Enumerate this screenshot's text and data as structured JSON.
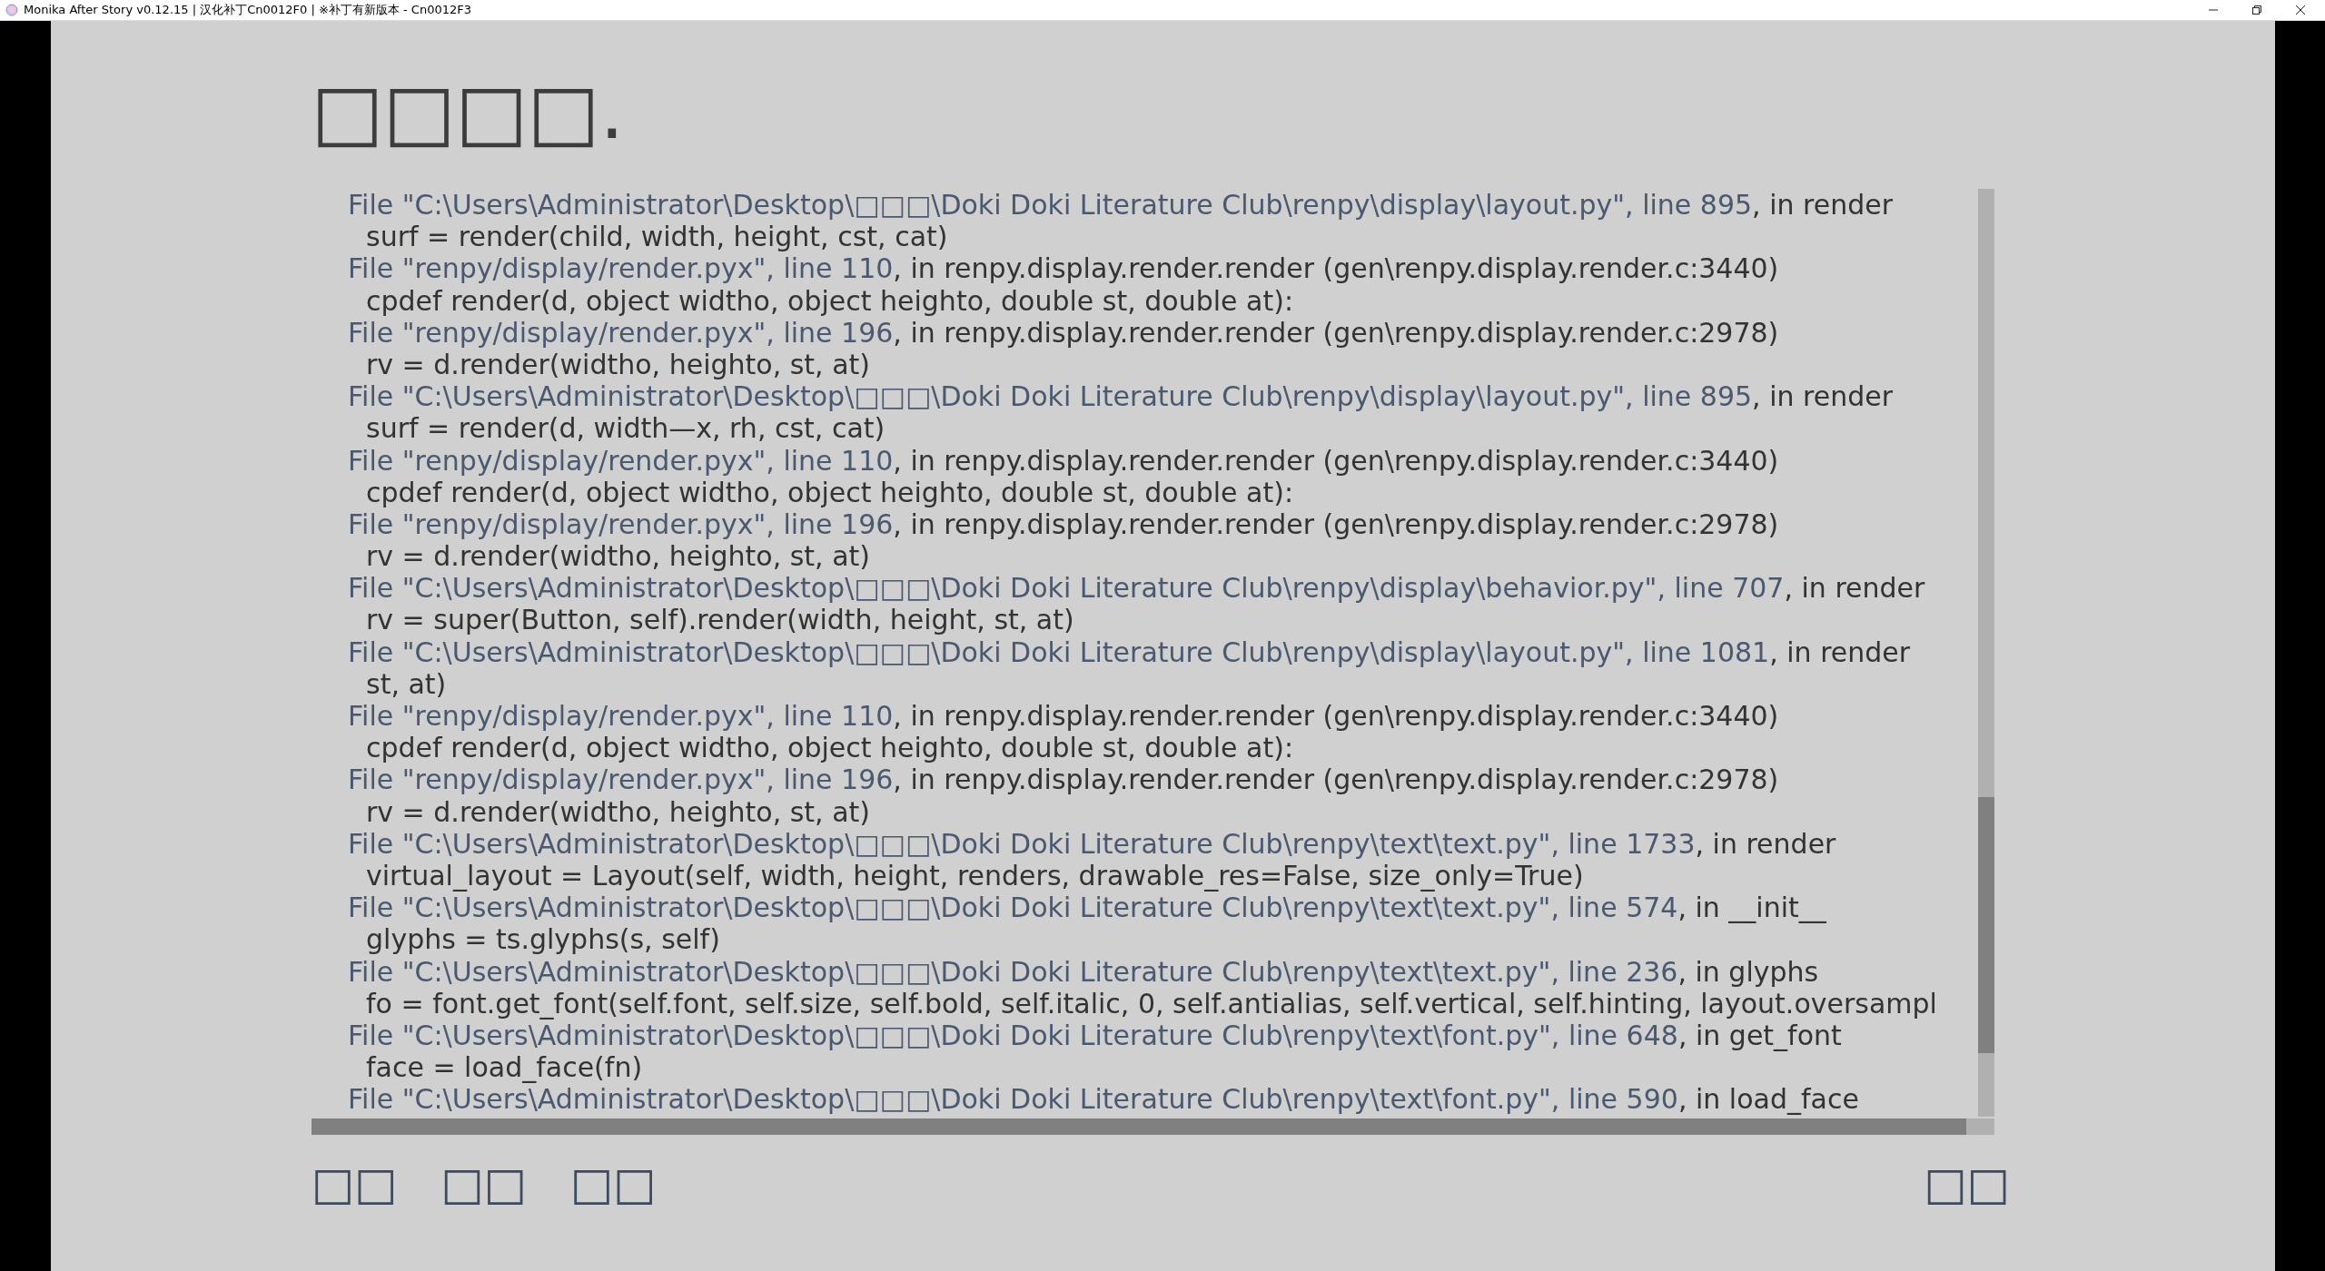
{
  "window": {
    "title": "Monika After Story v0.12.15 | 汉化补丁Cn0012F0 | ※补丁有新版本 - Cn0012F3"
  },
  "heading": "□□□□.",
  "traceback": [
    {
      "kind": "file",
      "location": "File \"C:\\Users\\Administrator\\Desktop\\□□□\\Doki Doki Literature Club\\renpy\\display\\layout.py\", line 895",
      "rest": ", in render"
    },
    {
      "kind": "code",
      "text": "surf = render(child, width, height, cst, cat)"
    },
    {
      "kind": "file",
      "location": "File \"renpy/display/render.pyx\", line 110",
      "rest": ", in renpy.display.render.render (gen\\renpy.display.render.c:3440)"
    },
    {
      "kind": "code",
      "text": "cpdef render(d, object widtho, object heighto, double st, double at):"
    },
    {
      "kind": "file",
      "location": "File \"renpy/display/render.pyx\", line 196",
      "rest": ", in renpy.display.render.render (gen\\renpy.display.render.c:2978)"
    },
    {
      "kind": "code",
      "text": "rv = d.render(widtho, heighto, st, at)"
    },
    {
      "kind": "file",
      "location": "File \"C:\\Users\\Administrator\\Desktop\\□□□\\Doki Doki Literature Club\\renpy\\display\\layout.py\", line 895",
      "rest": ", in render"
    },
    {
      "kind": "code",
      "text": "surf = render(d, width—x, rh, cst, cat)"
    },
    {
      "kind": "file",
      "location": "File \"renpy/display/render.pyx\", line 110",
      "rest": ", in renpy.display.render.render (gen\\renpy.display.render.c:3440)"
    },
    {
      "kind": "code",
      "text": "cpdef render(d, object widtho, object heighto, double st, double at):"
    },
    {
      "kind": "file",
      "location": "File \"renpy/display/render.pyx\", line 196",
      "rest": ", in renpy.display.render.render (gen\\renpy.display.render.c:2978)"
    },
    {
      "kind": "code",
      "text": "rv = d.render(widtho, heighto, st, at)"
    },
    {
      "kind": "file",
      "location": "File \"C:\\Users\\Administrator\\Desktop\\□□□\\Doki Doki Literature Club\\renpy\\display\\behavior.py\", line 707",
      "rest": ", in render"
    },
    {
      "kind": "code",
      "text": "rv = super(Button, self).render(width, height, st, at)"
    },
    {
      "kind": "file",
      "location": "File \"C:\\Users\\Administrator\\Desktop\\□□□\\Doki Doki Literature Club\\renpy\\display\\layout.py\", line 1081",
      "rest": ", in render"
    },
    {
      "kind": "code",
      "text": "st, at)"
    },
    {
      "kind": "file",
      "location": "File \"renpy/display/render.pyx\", line 110",
      "rest": ", in renpy.display.render.render (gen\\renpy.display.render.c:3440)"
    },
    {
      "kind": "code",
      "text": "cpdef render(d, object widtho, object heighto, double st, double at):"
    },
    {
      "kind": "file",
      "location": "File \"renpy/display/render.pyx\", line 196",
      "rest": ", in renpy.display.render.render (gen\\renpy.display.render.c:2978)"
    },
    {
      "kind": "code",
      "text": "rv = d.render(widtho, heighto, st, at)"
    },
    {
      "kind": "file",
      "location": "File \"C:\\Users\\Administrator\\Desktop\\□□□\\Doki Doki Literature Club\\renpy\\text\\text.py\", line 1733",
      "rest": ", in render"
    },
    {
      "kind": "code",
      "text": "virtual_layout = Layout(self, width, height, renders, drawable_res=False, size_only=True)"
    },
    {
      "kind": "file",
      "location": "File \"C:\\Users\\Administrator\\Desktop\\□□□\\Doki Doki Literature Club\\renpy\\text\\text.py\", line 574",
      "rest": ", in __init__"
    },
    {
      "kind": "code",
      "text": "glyphs = ts.glyphs(s, self)"
    },
    {
      "kind": "file",
      "location": "File \"C:\\Users\\Administrator\\Desktop\\□□□\\Doki Doki Literature Club\\renpy\\text\\text.py\", line 236",
      "rest": ", in glyphs"
    },
    {
      "kind": "code",
      "text": "fo = font.get_font(self.font, self.size, self.bold, self.italic, 0, self.antialias, self.vertical, self.hinting, layout.oversampl"
    },
    {
      "kind": "file",
      "location": "File \"C:\\Users\\Administrator\\Desktop\\□□□\\Doki Doki Literature Club\\renpy\\text\\font.py\", line 648",
      "rest": ", in get_font"
    },
    {
      "kind": "code",
      "text": "face = load_face(fn)"
    },
    {
      "kind": "file",
      "location": "File \"C:\\Users\\Administrator\\Desktop\\□□□\\Doki Doki Literature Club\\renpy\\text\\font.py\", line 590",
      "rest": ", in load_face"
    }
  ],
  "left_buttons": [
    "□□",
    "□□",
    "□□"
  ],
  "right_button": "□□"
}
